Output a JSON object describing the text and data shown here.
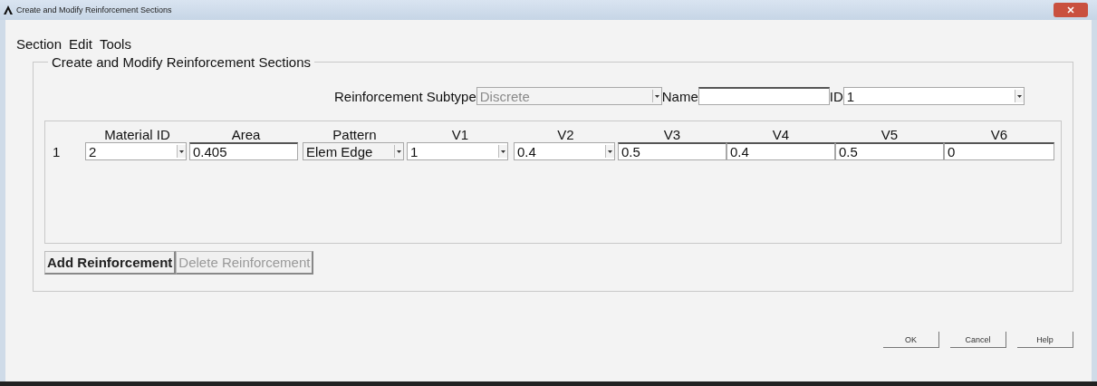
{
  "window": {
    "title": "Create and Modify Reinforcement Sections"
  },
  "menu": [
    "Section",
    "Edit",
    "Tools"
  ],
  "group": {
    "title": "Create and Modify Reinforcement Sections"
  },
  "subtype": {
    "label": "Reinforcement Subtype",
    "value": "Discrete",
    "disabled": true
  },
  "name": {
    "label": "Name"
  },
  "id": {
    "label": "ID",
    "value": "1"
  },
  "table": {
    "columns": [
      "Material ID",
      "Area",
      "Pattern",
      "V1",
      "V2",
      "V3",
      "V4",
      "V5",
      "V6"
    ],
    "rows": [
      {
        "number": "1",
        "cells": [
          {
            "kind": "combo",
            "value": "2"
          },
          {
            "kind": "input",
            "value": "0.405"
          },
          {
            "kind": "flatcombo",
            "value": "Elem Edge"
          },
          {
            "kind": "combo",
            "value": "1"
          },
          {
            "kind": "combo",
            "value": "0.4"
          },
          {
            "kind": "input",
            "value": "0.5"
          },
          {
            "kind": "input",
            "value": "0.4"
          },
          {
            "kind": "input",
            "value": "0.5"
          },
          {
            "kind": "input",
            "value": "0"
          }
        ]
      }
    ]
  },
  "actions": [
    {
      "label": "Add Reinforcement",
      "disabled": false
    },
    {
      "label": "Delete Reinforcement",
      "disabled": true
    }
  ],
  "buttons": [
    "OK",
    "Cancel",
    "Help"
  ]
}
